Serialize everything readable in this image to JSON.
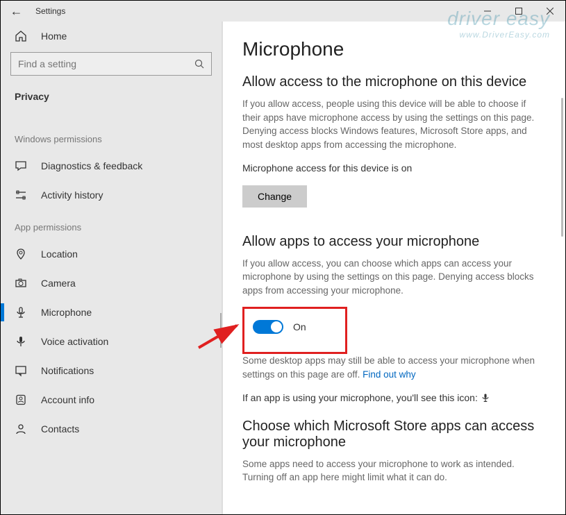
{
  "window": {
    "title": "Settings",
    "minimize": "—",
    "maximize": "▢",
    "close": "✕"
  },
  "sidebar": {
    "home": "Home",
    "search_placeholder": "Find a setting",
    "current_category": "Privacy",
    "section_windows": "Windows permissions",
    "section_app": "App permissions",
    "win_items": [
      {
        "label": "Diagnostics & feedback"
      },
      {
        "label": "Activity history"
      }
    ],
    "app_items": [
      {
        "label": "Location"
      },
      {
        "label": "Camera"
      },
      {
        "label": "Microphone",
        "active": true
      },
      {
        "label": "Voice activation"
      },
      {
        "label": "Notifications"
      },
      {
        "label": "Account info"
      },
      {
        "label": "Contacts"
      }
    ]
  },
  "main": {
    "title": "Microphone",
    "section1": {
      "heading": "Allow access to the microphone on this device",
      "body": "If you allow access, people using this device will be able to choose if their apps have microphone access by using the settings on this page. Denying access blocks Windows features, Microsoft Store apps, and most desktop apps from accessing the microphone.",
      "status": "Microphone access for this device is on",
      "change_btn": "Change"
    },
    "section2": {
      "heading": "Allow apps to access your microphone",
      "body": "If you allow access, you can choose which apps can access your microphone by using the settings on this page. Denying access blocks apps from accessing your microphone.",
      "toggle_state": "On",
      "desktop_note_pre": "Some desktop apps may still be able to access your microphone when settings on this page are off. ",
      "desktop_note_link": "Find out why",
      "usage_note": "If an app is using your microphone, you'll see this icon:"
    },
    "section3": {
      "heading": "Choose which Microsoft Store apps can access your microphone",
      "body": "Some apps need to access your microphone to work as intended. Turning off an app here might limit what it can do."
    }
  },
  "watermark": {
    "main": "driver easy",
    "sub": "www.DriverEasy.com"
  }
}
